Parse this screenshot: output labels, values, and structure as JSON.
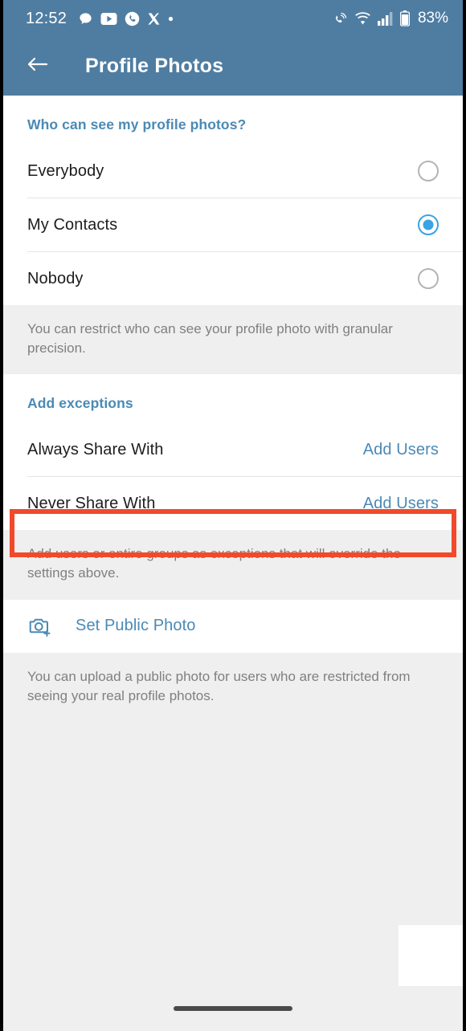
{
  "status_bar": {
    "time": "12:52",
    "battery_percent": "83%",
    "left_icons": [
      "chat-bubble-icon",
      "youtube-icon",
      "phone-circle-icon",
      "x-twitter-icon",
      "dot-icon"
    ],
    "right_icons": [
      "call-wifi-icon",
      "wifi-icon",
      "signal-bars-icon",
      "battery-icon"
    ]
  },
  "app_bar": {
    "back_icon": "arrow-back-icon",
    "title": "Profile Photos",
    "background_color": "#4f7da2"
  },
  "visibility_section": {
    "header": "Who can see my profile photos?",
    "options": [
      {
        "label": "Everybody",
        "selected": false
      },
      {
        "label": "My Contacts",
        "selected": true
      },
      {
        "label": "Nobody",
        "selected": false
      }
    ],
    "footer": "You can restrict who can see your profile photo with granular precision."
  },
  "exceptions_section": {
    "header": "Add exceptions",
    "rows": [
      {
        "label": "Always Share With",
        "action": "Add Users",
        "highlighted": true
      },
      {
        "label": "Never Share With",
        "action": "Add Users",
        "highlighted": false
      }
    ],
    "footer": "Add users or entire groups as exceptions that will override the settings above."
  },
  "public_photo_section": {
    "icon": "camera-plus-icon",
    "label": "Set Public Photo",
    "footer": "You can upload a public photo for users who are restricted from seeing your real profile photos."
  },
  "colors": {
    "accent_blue": "#4a8ab5",
    "radio_selected": "#3ba2e4",
    "highlight_red": "#f2492a",
    "app_bar": "#4f7da2",
    "page_background": "#efefef"
  },
  "navigation": {
    "gesture_pill": "home-gesture-pill"
  }
}
